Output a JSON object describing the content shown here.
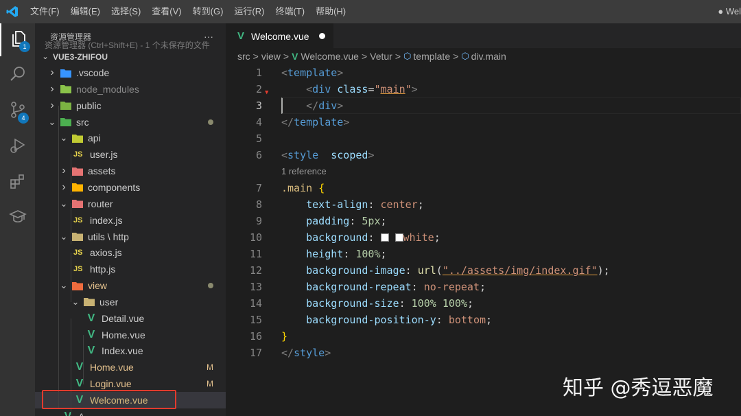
{
  "titlebar": {
    "menu": [
      "文件(F)",
      "编辑(E)",
      "选择(S)",
      "查看(V)",
      "转到(G)",
      "运行(R)",
      "终端(T)",
      "帮助(H)"
    ],
    "title": "● Wel"
  },
  "activity": {
    "explorer_badge": "1",
    "scm_badge": "4",
    "icons": [
      "files-icon",
      "search-icon",
      "source-control-icon",
      "run-debug-icon",
      "extensions-icon",
      "remote-icon"
    ]
  },
  "sidebar": {
    "title": "资源管理器",
    "tooltip": "资源管理器 (Ctrl+Shift+E) - 1 个未保存的文件",
    "more": "···",
    "root": "VUE3-ZHIFOU",
    "items": [
      {
        "label": ".vscode",
        "type": "folder",
        "expanded": false,
        "depth": 0,
        "icon": "vscode-folder-icon"
      },
      {
        "label": "node_modules",
        "type": "folder",
        "expanded": false,
        "depth": 0,
        "icon": "node-folder-icon",
        "dim": true
      },
      {
        "label": "public",
        "type": "folder",
        "expanded": false,
        "depth": 0,
        "icon": "public-folder-icon"
      },
      {
        "label": "src",
        "type": "folder",
        "expanded": true,
        "depth": 0,
        "icon": "src-folder-icon",
        "modified_dot": true
      },
      {
        "label": "api",
        "type": "folder",
        "expanded": true,
        "depth": 1,
        "icon": "api-folder-icon"
      },
      {
        "label": "user.js",
        "type": "js",
        "depth": 2
      },
      {
        "label": "assets",
        "type": "folder",
        "expanded": false,
        "depth": 1,
        "icon": "assets-folder-icon"
      },
      {
        "label": "components",
        "type": "folder",
        "expanded": false,
        "depth": 1,
        "icon": "components-folder-icon"
      },
      {
        "label": "router",
        "type": "folder",
        "expanded": true,
        "depth": 1,
        "icon": "router-folder-icon"
      },
      {
        "label": "index.js",
        "type": "js",
        "depth": 2
      },
      {
        "label": "utils \\ http",
        "type": "folder",
        "expanded": true,
        "depth": 1,
        "icon": "utils-folder-icon"
      },
      {
        "label": "axios.js",
        "type": "js",
        "depth": 2
      },
      {
        "label": "http.js",
        "type": "js",
        "depth": 2
      },
      {
        "label": "view",
        "type": "folder",
        "expanded": true,
        "depth": 1,
        "icon": "view-folder-icon",
        "modified_dot": true,
        "modified_color": true
      },
      {
        "label": "user",
        "type": "folder",
        "expanded": true,
        "depth": 2,
        "icon": "user-folder-icon"
      },
      {
        "label": "Detail.vue",
        "type": "vue",
        "depth": 3
      },
      {
        "label": "Home.vue",
        "type": "vue",
        "depth": 3
      },
      {
        "label": "Index.vue",
        "type": "vue",
        "depth": 3
      },
      {
        "label": "Home.vue",
        "type": "vue",
        "depth": 2,
        "status": "M"
      },
      {
        "label": "Login.vue",
        "type": "vue",
        "depth": 2,
        "status": "M"
      },
      {
        "label": "Welcome.vue",
        "type": "vue",
        "depth": 2,
        "selected": true
      },
      {
        "label": "A...",
        "type": "vue",
        "depth": 1
      }
    ]
  },
  "editor": {
    "tab_label": "Welcome.vue",
    "breadcrumb": [
      "src",
      "view",
      "Welcome.vue",
      "Vetur",
      "template",
      "div.main"
    ],
    "codelens": "1 reference",
    "line_numbers": [
      "1",
      "2",
      "3",
      "4",
      "5",
      "6",
      "7",
      "8",
      "9",
      "10",
      "11",
      "12",
      "13",
      "14",
      "15",
      "16",
      "17"
    ],
    "current_line": "3"
  },
  "watermark": "知乎 @秀逗恶魔"
}
